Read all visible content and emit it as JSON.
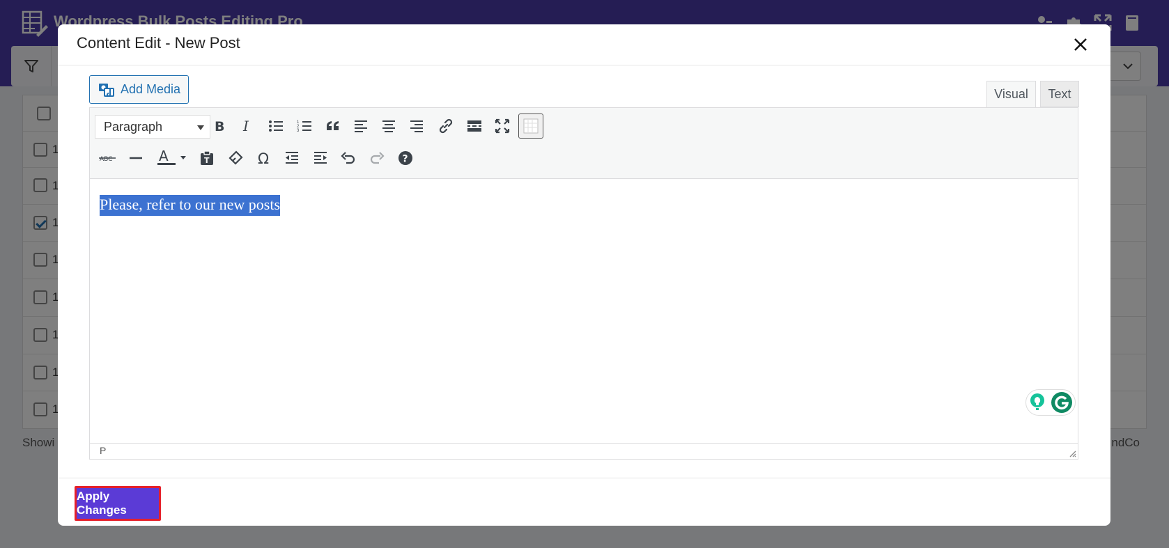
{
  "app": {
    "title": "Wordpress Bulk Posts Editing Pro",
    "footer_left": "Showi",
    "footer_right": "ndCo",
    "row_numbers": [
      "1",
      "1",
      "1",
      "1",
      "1",
      "1",
      "1",
      "1"
    ],
    "row_checked": [
      false,
      false,
      true,
      false,
      false,
      false,
      false,
      false
    ]
  },
  "modal": {
    "title": "Content Edit - New Post",
    "add_media_label": "Add Media",
    "tabs": {
      "visual": "Visual",
      "text": "Text"
    },
    "format_select_value": "Paragraph",
    "content_text": "Please, refer to our new posts",
    "status_path": "P",
    "apply_label": "Apply Changes"
  },
  "colors": {
    "header_bg": "#4b3aa8",
    "apply_bg": "#5b3bd6",
    "apply_border": "#e5202a",
    "selection": "#3c72d1",
    "link_blue": "#2271b1"
  },
  "toolbar_row1_icons": [
    "bold-icon",
    "italic-icon",
    "bullet-list-icon",
    "numbered-list-icon",
    "blockquote-icon",
    "align-left-icon",
    "align-center-icon",
    "align-right-icon",
    "link-icon",
    "read-more-icon",
    "fullscreen-icon",
    "toolbar-toggle-icon"
  ],
  "toolbar_row2_icons": [
    "strikethrough-icon",
    "horizontal-line-icon",
    "text-color-icon",
    "paste-text-icon",
    "clear-formatting-icon",
    "special-character-icon",
    "outdent-icon",
    "indent-icon",
    "undo-icon",
    "redo-icon",
    "help-icon"
  ]
}
